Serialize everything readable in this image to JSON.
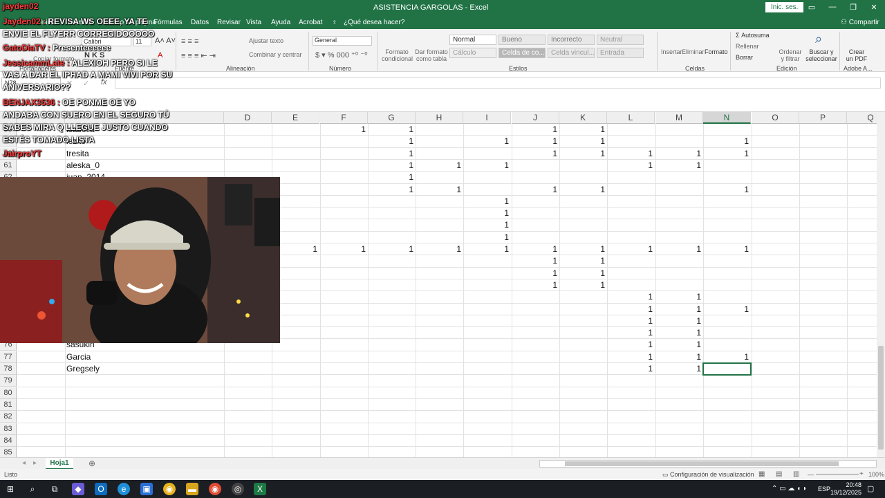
{
  "window": {
    "title": "ASISTENCIA GARGOLAS  -  Excel",
    "signin_label": "Inic. ses.",
    "share_label": "Compartir"
  },
  "menu": {
    "items": [
      "Archivo",
      "Inicio",
      "Insertar",
      "Diseño de página",
      "Fórmulas",
      "Datos",
      "Revisar",
      "Vista",
      "Ayuda",
      "Acrobat"
    ],
    "tell_me": "¿Qué desea hacer?"
  },
  "ribbon": {
    "font_name": "Calibri",
    "font_size": "11",
    "number_format": "General",
    "wrap_text": "Ajustar texto",
    "merge_center": "Combinar y centrar",
    "cond_format": "Formato condicional",
    "format_table": "Dar formato como tabla",
    "styles": [
      "Normal",
      "Bueno",
      "Incorrecto",
      "Neutral",
      "Cálculo",
      "Celda de co...",
      "Celda vincul...",
      "Entrada"
    ],
    "insert": "Insertar",
    "delete": "Eliminar",
    "format": "Formato",
    "autosum": "Autosuma",
    "fill": "Rellenar",
    "clear": "Borrar",
    "sort_filter": "Ordenar y filtrar",
    "find_select": "Buscar y seleccionar",
    "create_pdf": "Crear un PDF",
    "group_labels": {
      "clipboard": "Portapapeles",
      "font": "Fuente",
      "alignment": "Alineación",
      "number": "Número",
      "styles": "Estilos",
      "cells": "Celdas",
      "editing": "Edición",
      "adobe": "Adobe A..."
    },
    "paste": "Pegar",
    "copy_format": "Copiar formato"
  },
  "namebox": "N78",
  "columns": [
    "D",
    "E",
    "F",
    "G",
    "H",
    "I",
    "J",
    "K",
    "L",
    "M",
    "N",
    "O",
    "P",
    "Q"
  ],
  "selected_column": "N",
  "rows": [
    {
      "num": "58",
      "name": "isabella",
      "vals": {
        "F": "1",
        "G": "1",
        "J": "1",
        "K": "1"
      }
    },
    {
      "num": "59",
      "name": "lezito",
      "vals": {
        "G": "1",
        "I": "1",
        "J": "1",
        "K": "1",
        "N": "1"
      }
    },
    {
      "num": "60",
      "name": "tresita",
      "vals": {
        "G": "1",
        "J": "1",
        "K": "1",
        "L": "1",
        "M": "1",
        "N": "1"
      }
    },
    {
      "num": "61",
      "name": "aleska_0",
      "vals": {
        "G": "1",
        "H": "1",
        "I": "1",
        "L": "1",
        "M": "1"
      }
    },
    {
      "num": "62",
      "name": "juan_2014",
      "vals": {
        "G": "1"
      }
    },
    {
      "num": "63",
      "name": "",
      "vals": {
        "G": "1",
        "H": "1",
        "J": "1",
        "K": "1",
        "N": "1"
      }
    },
    {
      "num": "64",
      "name": "",
      "vals": {
        "I": "1"
      }
    },
    {
      "num": "65",
      "name": "",
      "vals": {
        "I": "1"
      }
    },
    {
      "num": "66",
      "name": "",
      "vals": {
        "I": "1"
      }
    },
    {
      "num": "67",
      "name": "",
      "vals": {
        "I": "1"
      }
    },
    {
      "num": "68",
      "name": "",
      "vals": {
        "E": "1",
        "F": "1",
        "G": "1",
        "H": "1",
        "I": "1",
        "J": "1",
        "K": "1",
        "L": "1",
        "M": "1",
        "N": "1"
      }
    },
    {
      "num": "69",
      "name": "",
      "vals": {
        "J": "1",
        "K": "1"
      }
    },
    {
      "num": "70",
      "name": "",
      "vals": {
        "J": "1",
        "K": "1"
      }
    },
    {
      "num": "71",
      "name": "",
      "vals": {
        "J": "1",
        "K": "1"
      }
    },
    {
      "num": "72",
      "name": "",
      "vals": {
        "L": "1",
        "M": "1"
      }
    },
    {
      "num": "73",
      "name": "",
      "vals": {
        "L": "1",
        "M": "1",
        "N": "1"
      }
    },
    {
      "num": "74",
      "name": "",
      "vals": {
        "L": "1",
        "M": "1"
      }
    },
    {
      "num": "75",
      "name": "",
      "vals": {
        "L": "1",
        "M": "1"
      }
    },
    {
      "num": "76",
      "name": "sasukin",
      "vals": {
        "L": "1",
        "M": "1"
      }
    },
    {
      "num": "77",
      "name": "Garcia",
      "vals": {
        "L": "1",
        "M": "1",
        "N": "1"
      }
    },
    {
      "num": "78",
      "name": "Gregsely",
      "vals": {
        "L": "1",
        "M": "1"
      }
    },
    {
      "num": "79",
      "name": "",
      "vals": {}
    },
    {
      "num": "80",
      "name": "",
      "vals": {}
    },
    {
      "num": "81",
      "name": "",
      "vals": {}
    },
    {
      "num": "82",
      "name": "",
      "vals": {}
    },
    {
      "num": "83",
      "name": "",
      "vals": {}
    },
    {
      "num": "84",
      "name": "",
      "vals": {}
    },
    {
      "num": "85",
      "name": "",
      "vals": {}
    }
  ],
  "sheet_tabs": [
    "Hoja1"
  ],
  "status": {
    "ready": "Listo",
    "display_settings": "Configuración de visualización",
    "zoom": "100%"
  },
  "taskbar": {
    "time": "20:48",
    "date": "19/12/2025",
    "lang": "ESP"
  },
  "chat": [
    {
      "user": "jayden02",
      "text": ""
    },
    {
      "user": "Jayden02",
      "text": "REVISA WS OEEE, YA TE"
    },
    {
      "user": "",
      "text": "ENVIE EL FLYERR CORREGIDOOOOO"
    },
    {
      "user": "GatoDiaTV",
      "text": "Presenteeeeee"
    },
    {
      "user": "JessicammLate",
      "text": "ALEXIOH PERO SI LE"
    },
    {
      "user": "",
      "text": "VAS A DAR EL IPHAD A MAMI VIVI POR SU"
    },
    {
      "user": "",
      "text": "ANIVERSARIO??"
    },
    {
      "user": "BENJAX3536",
      "text": "OE PONME OE YO"
    },
    {
      "user": "",
      "text": "ANDABA CON SUERO EN EL SEGURO TÚ"
    },
    {
      "user": "",
      "text": "SABES MIRA Q LLEGUE JUSTO CUANDO"
    },
    {
      "user": "",
      "text": "ESTÉS TOMADO LISTA"
    },
    {
      "user": "JairproYT",
      "text": ""
    }
  ]
}
